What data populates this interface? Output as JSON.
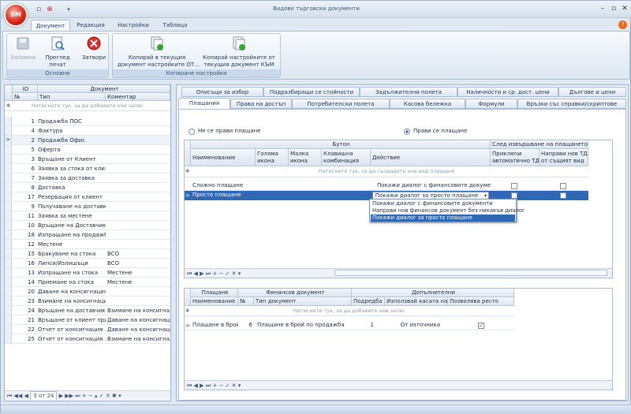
{
  "app": {
    "title": "Видове търговски документи",
    "orb_label": "SM"
  },
  "ribbon_tabs": [
    "Документ",
    "Редакция",
    "Настройки",
    "Таблица"
  ],
  "ribbon": {
    "group_basic": {
      "label": "Основни",
      "save": "Запомни",
      "preview": "Преглед\nпечат",
      "close": "Затвори"
    },
    "group_copy": {
      "label": "Копиране настройки",
      "copy_to": "Копирай в текущия\nдокумент настройките ОТ...",
      "copy_from": "Копирай настройките от\nтекущия документ КЪМ"
    }
  },
  "left_grid": {
    "headers": {
      "id": "ID",
      "document": "Документ",
      "no": "№",
      "type": "Тип",
      "comment": "Коментар"
    },
    "new_row": "Натиснете тук, за да добавите нов запис",
    "rows": [
      {
        "id": "1",
        "type": "Продажба ПОС",
        "comment": ""
      },
      {
        "id": "4",
        "type": "Фактура",
        "comment": ""
      },
      {
        "id": "2",
        "type": "Продажба Офис",
        "comment": ""
      },
      {
        "id": "5",
        "type": "Оферта",
        "comment": ""
      },
      {
        "id": "3",
        "type": "Връщане от Клиент",
        "comment": ""
      },
      {
        "id": "6",
        "type": "Заявка за стока от кли...",
        "comment": ""
      },
      {
        "id": "7",
        "type": "Заявка за доставка",
        "comment": ""
      },
      {
        "id": "8",
        "type": "Доставка",
        "comment": ""
      },
      {
        "id": "17",
        "type": "Резервация от клиент",
        "comment": ""
      },
      {
        "id": "9",
        "type": "Получаване на доставк...",
        "comment": ""
      },
      {
        "id": "11",
        "type": "Заявка за местене",
        "comment": ""
      },
      {
        "id": "10",
        "type": "Връщане на Доставчик",
        "comment": ""
      },
      {
        "id": "18",
        "type": "Изпращане на продажба",
        "comment": ""
      },
      {
        "id": "12",
        "type": "Местене",
        "comment": ""
      },
      {
        "id": "15",
        "type": "Бракуване на стока",
        "comment": "BCO"
      },
      {
        "id": "16",
        "type": "Липси/Излишъци",
        "comment": "BCO"
      },
      {
        "id": "13",
        "type": "Изпращане на стока",
        "comment": "Местене"
      },
      {
        "id": "14",
        "type": "Приемане на стока",
        "comment": "Местене"
      },
      {
        "id": "20",
        "type": "Даване на консигнация",
        "comment": ""
      },
      {
        "id": "23",
        "type": "Взимане на консигнация",
        "comment": ""
      },
      {
        "id": "24",
        "type": "Връщане на доставчик ...",
        "comment": "Взимане на консигна..."
      },
      {
        "id": "21",
        "type": "Връщане от клиент при...",
        "comment": "Даване на консигнация"
      },
      {
        "id": "22",
        "type": "Отчет от консигнация ...",
        "comment": "Даване на консигнация"
      },
      {
        "id": "25",
        "type": "Отчет от консигнация ...",
        "comment": "Взимане на консигна..."
      }
    ],
    "nav": {
      "position": "3 от 24"
    }
  },
  "tabs_row1": [
    "Описъци за избор",
    "Подразбиращи се стойности",
    "Задължителни полета",
    "Наличности и ср. дост. цени",
    "Дългове и цени"
  ],
  "tabs_row2": [
    "Плащания",
    "Права на достъп",
    "Потребителски полета",
    "Касова бележка",
    "Формули",
    "Връзки със справки/скриптове"
  ],
  "payment": {
    "radio_no": "Не се прави плащане",
    "radio_yes": "Прави се плащане",
    "grid": {
      "band_button": "Бутон",
      "band_after": "След извършване на плащането",
      "col_name": "Наименование",
      "col_big": "Голяма\nикона",
      "col_small": "Малка\nикона",
      "col_combo": "Клавишна\nкомбинация",
      "col_action": "Действие",
      "col_close": "Приключи\nавтоматично ТД",
      "col_new": "Направи нов ТД\nот същият вид",
      "new_row": "Натиснете тук, за да създадете нов вид плащане",
      "rows": [
        {
          "name": "Сложно плащане",
          "action": "Покажи диалог с финансовите документи"
        },
        {
          "name": "Просто плащане",
          "action": "Покажи диалог за просто плащане"
        }
      ]
    },
    "dropdown_options": [
      "Покажи диалог с финансовите документи",
      "Направи нов финансов документ без никакъв диалог",
      "Покажи диалог за просто плащане"
    ]
  },
  "fin_grid": {
    "band_payment": "Плащане",
    "band_fin": "Финансов документ",
    "band_extra": "Допълнителни",
    "col_name": "Наименование",
    "col_no": "№",
    "col_type": "Тип документ",
    "col_order": "Подредба",
    "col_cash": "Използвай касата на",
    "col_change": "Позволява ресто",
    "new_row": "Натиснете тук, за да добавите нов запис",
    "rows": [
      {
        "name": "Плащане в брой г",
        "no": "6",
        "type": "Плащане в брой по продажба",
        "order": "1",
        "cash": "От източника"
      }
    ]
  }
}
